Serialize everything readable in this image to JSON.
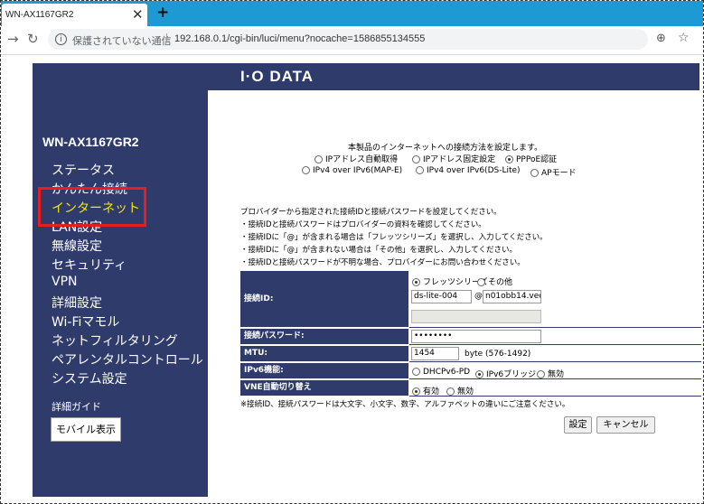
{
  "browser": {
    "tab_title": "WN-AX1167GR2",
    "tab_close": "✕",
    "new_tab": "+",
    "insecure_label": "保護されていない通信",
    "url": "192.168.0.1/cgi-bin/luci/menu?nocache=1586855134555"
  },
  "header": {
    "logo": "I·O DATA"
  },
  "sidebar": {
    "model": "WN-AX1167GR2",
    "items": [
      {
        "label": "ステータス"
      },
      {
        "label": "かんたん接続"
      },
      {
        "label": "インターネット"
      },
      {
        "label": "LAN設定"
      },
      {
        "label": "無線設定"
      },
      {
        "label": "セキュリティ"
      },
      {
        "label": "VPN"
      },
      {
        "label": "詳細設定"
      },
      {
        "label": "Wi-Fiマモル"
      },
      {
        "label": "ネットフィルタリング"
      },
      {
        "label": "ペアレンタルコントロール"
      },
      {
        "label": "システム設定"
      }
    ],
    "guide": "詳細ガイド",
    "mobile_button": "モバイル表示"
  },
  "main": {
    "title": "本製品のインターネットへの接続方法を設定します。",
    "connection_options": [
      {
        "label": "IPアドレス自動取得",
        "selected": false
      },
      {
        "label": "IPアドレス固定設定",
        "selected": false
      },
      {
        "label": "PPPoE認証",
        "selected": true
      },
      {
        "label": "IPv4 over IPv6(MAP-E)",
        "selected": false
      },
      {
        "label": "IPv4 over IPv6(DS-Lite)",
        "selected": false
      },
      {
        "label": "APモード",
        "selected": false
      }
    ],
    "info_lines": [
      "プロバイダーから指定された接続IDと接続パスワードを設定してください。",
      "・接続IDと接続パスワードはプロバイダーの資料を確認してください。",
      "・接続IDに「@」が含まれる場合は「フレッツシリーズ」を選択し、入力してください。",
      "・接続IDに「@」が含まれない場合は「その他」を選択し、入力してください。",
      "・接続IDと接続パスワードが不明な場合、プロバイダーにお問い合わせください。"
    ],
    "form": {
      "id_label": "接続ID:",
      "id_type_options": [
        {
          "label": "フレッツシリーズ",
          "selected": true
        },
        {
          "label": "その他",
          "selected": false
        }
      ],
      "id_user": "ds-lite-004",
      "at_sign": "@",
      "id_domain": "n01obb14.vec",
      "password_label": "接続パスワード:",
      "password_value": "••••••••",
      "mtu_label": "MTU:",
      "mtu_value": "1454",
      "mtu_unit": "byte (576-1492)",
      "ipv6_label": "IPv6機能:",
      "ipv6_options": [
        {
          "label": "DHCPv6-PD",
          "selected": false
        },
        {
          "label": "IPv6ブリッジ",
          "selected": true
        },
        {
          "label": "無効",
          "selected": false
        }
      ],
      "vne_label": "VNE自動切り替え",
      "vne_options": [
        {
          "label": "有効",
          "selected": true
        },
        {
          "label": "無効",
          "selected": false
        }
      ],
      "note": "※接続ID、接続パスワードは大文字、小文字、数字、アルファベットの違いにご注意ください。",
      "save_button": "設定",
      "cancel_button": "キャンセル"
    }
  }
}
